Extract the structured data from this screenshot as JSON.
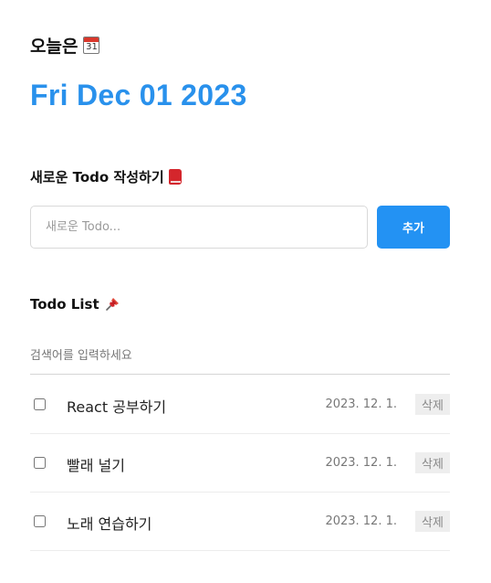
{
  "header": {
    "label": "오늘은",
    "calendar_icon": "calendar-icon",
    "calendar_day": "31",
    "date": "Fri Dec 01 2023"
  },
  "editor": {
    "title": "새로운 Todo 작성하기",
    "title_icon": "red-book-icon",
    "input_placeholder": "새로운 Todo...",
    "input_value": "",
    "add_label": "추가"
  },
  "list": {
    "title": "Todo List",
    "title_icon": "pushpin-icon",
    "search_placeholder": "검색어를 입력하세요",
    "search_value": "",
    "items": [
      {
        "content": "React 공부하기",
        "date": "2023. 12. 1.",
        "done": false,
        "delete_label": "삭제"
      },
      {
        "content": "빨래 널기",
        "date": "2023. 12. 1.",
        "done": false,
        "delete_label": "삭제"
      },
      {
        "content": "노래 연습하기",
        "date": "2023. 12. 1.",
        "done": false,
        "delete_label": "삭제"
      }
    ]
  },
  "colors": {
    "accent": "#2991ec",
    "button": "#2392f3",
    "delete_bg": "#eeeeee"
  }
}
